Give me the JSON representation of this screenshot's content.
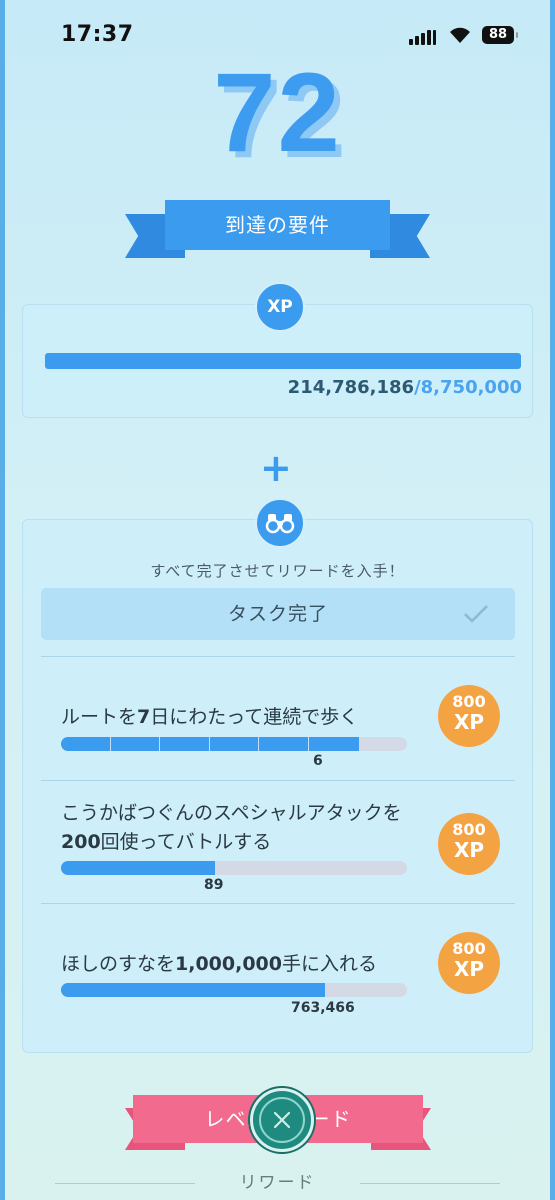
{
  "status": {
    "time": "17:37",
    "battery": "88"
  },
  "level": "72",
  "requirements_banner": "到達の要件",
  "xp": {
    "badge": "XP",
    "current": "214,786,186",
    "goal": "/8,750,000",
    "progress": 1.0
  },
  "plus": "+",
  "tasks_section": {
    "instruction": "すべて完了させてリワードを入手！",
    "done_label": "タスク完了",
    "tasks": [
      {
        "pre": "ルートを",
        "bold": "7",
        "post": "日にわたって連続で歩く",
        "progress_value": "6",
        "progress": 0.86,
        "reward_amount": "800",
        "reward_unit": "XP"
      },
      {
        "pre": "こうかばつぐんのスペシャルアタックを",
        "bold": "200",
        "post": "回使ってバトルする",
        "progress_value": "89",
        "progress": 0.445,
        "reward_amount": "800",
        "reward_unit": "XP"
      },
      {
        "pre": "ほしのすなを",
        "bold": "1,000,000",
        "post": "手に入れる",
        "progress_value": "763,466",
        "progress": 0.763,
        "reward_amount": "800",
        "reward_unit": "XP"
      }
    ]
  },
  "level_reward_banner": "レベルリワード",
  "rewards_label": "リワード",
  "icons": {
    "close": "close-icon",
    "binoculars": "binoculars-icon",
    "check": "check-icon"
  },
  "colors": {
    "accent": "#3b9bee",
    "reward": "#f4a343",
    "banner_red": "#f26a8d",
    "close": "#1f8a80"
  }
}
